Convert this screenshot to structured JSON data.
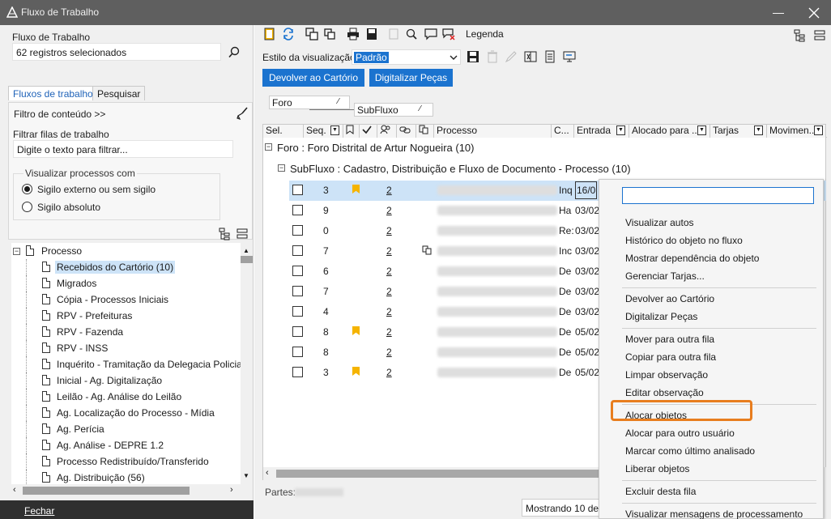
{
  "window": {
    "title": "Fluxo de Trabalho",
    "minimize": "—",
    "close": "✕"
  },
  "left": {
    "workflow_label": "Fluxo de Trabalho",
    "workflow_value": "62 registros selecionados",
    "tabs": [
      "Fluxos de trabalho",
      "Pesquisar"
    ],
    "content_filter": "Filtro de conteúdo >>",
    "filter_queues_label": "Filtrar filas de trabalho",
    "filter_placeholder": "Digite o texto para filtrar...",
    "view_group_label": "Visualizar processos com",
    "radio_external": "Sigilo externo ou sem sigilo",
    "radio_absolute": "Sigilo absoluto",
    "tree_root": "Processo",
    "tree_items": [
      "Recebidos do Cartório (10)",
      "Migrados",
      "Cópia - Processos Iniciais",
      "RPV - Prefeituras",
      "RPV - Fazenda",
      "RPV - INSS",
      "Inquérito - Tramitação da Delegacia Policia",
      "Inicial - Ag. Digitalização",
      "Leilão - Ag. Análise do Leilão",
      "Ag. Localização do Processo - Mídia",
      "Ag. Perícia",
      "Ag. Análise - DEPRE 1.2",
      "Processo Redistribuído/Transferido",
      "Ag. Distribuição (56)"
    ],
    "close_label": "Fechar"
  },
  "toolbar": {
    "legend": "Legenda",
    "view_style_label": "Estilo da visualização",
    "view_style_value": "Padrão",
    "btn_return": "Devolver ao Cartório",
    "btn_digitize": "Digitalizar Peças"
  },
  "grouping": {
    "chip1": "Foro",
    "chip2": "SubFluxo"
  },
  "grid": {
    "headers": [
      "Sel.",
      "Seq.",
      "Processo",
      "C...",
      "Entrada",
      "Alocado para ...",
      "Tarjas",
      "Movimen..."
    ],
    "group1": "Foro : Foro Distrital de Artur Nogueira  (10)",
    "group2": "SubFluxo : Cadastro, Distribuição e Fluxo de Documento - Processo  (10)",
    "rows": [
      {
        "seq": "3",
        "n": "2",
        "c": "Inq",
        "entry": "16/0",
        "bookmark": true,
        "selected": true,
        "link": false
      },
      {
        "seq": "9",
        "n": "2",
        "c": "Ha",
        "entry": "03/02",
        "bookmark": false,
        "selected": false,
        "link": false
      },
      {
        "seq": "0",
        "n": "2",
        "c": "Re:",
        "entry": "03/02",
        "bookmark": false,
        "selected": false,
        "link": false
      },
      {
        "seq": "7",
        "n": "2",
        "c": "Inc",
        "entry": "03/02",
        "bookmark": false,
        "selected": false,
        "link": true
      },
      {
        "seq": "6",
        "n": "2",
        "c": "De",
        "entry": "03/02",
        "bookmark": false,
        "selected": false,
        "link": false
      },
      {
        "seq": "7",
        "n": "2",
        "c": "De",
        "entry": "03/02",
        "bookmark": false,
        "selected": false,
        "link": false
      },
      {
        "seq": "4",
        "n": "2",
        "c": "De",
        "entry": "03/02",
        "bookmark": false,
        "selected": false,
        "link": false
      },
      {
        "seq": "8",
        "n": "2",
        "c": "De",
        "entry": "05/02",
        "bookmark": true,
        "selected": false,
        "link": false
      },
      {
        "seq": "8",
        "n": "2",
        "c": "De",
        "entry": "05/02",
        "bookmark": false,
        "selected": false,
        "link": false
      },
      {
        "seq": "3",
        "n": "2",
        "c": "De",
        "entry": "05/02",
        "bookmark": true,
        "selected": false,
        "link": false
      }
    ],
    "parts_label": "Partes:",
    "showing": "Mostrando 10 de"
  },
  "context_menu": [
    {
      "label": "Visualizar autos",
      "group": 0
    },
    {
      "label": "Histórico do objeto no fluxo",
      "group": 0
    },
    {
      "label": "Mostrar dependência do objeto",
      "group": 0
    },
    {
      "label": "Gerenciar Tarjas...",
      "group": 0
    },
    {
      "label": "Devolver ao Cartório",
      "group": 1
    },
    {
      "label": "Digitalizar Peças",
      "group": 1
    },
    {
      "label": "Mover para outra fila",
      "group": 2
    },
    {
      "label": "Copiar para outra fila",
      "group": 2
    },
    {
      "label": "Limpar observação",
      "group": 2
    },
    {
      "label": "Editar observação",
      "group": 2
    },
    {
      "label": "Alocar objetos",
      "group": 3,
      "highlight": true
    },
    {
      "label": "Alocar para outro usuário",
      "group": 3
    },
    {
      "label": "Marcar como último analisado",
      "group": 3
    },
    {
      "label": "Liberar objetos",
      "group": 3
    },
    {
      "label": "Excluir desta fila",
      "group": 4
    },
    {
      "label": "Visualizar mensagens de processamento",
      "group": 5
    }
  ],
  "colors": {
    "accent": "#1b73cf",
    "highlight": "#e87d1e",
    "bookmark": "#f5b400",
    "titlebar": "#5f5f5f"
  }
}
